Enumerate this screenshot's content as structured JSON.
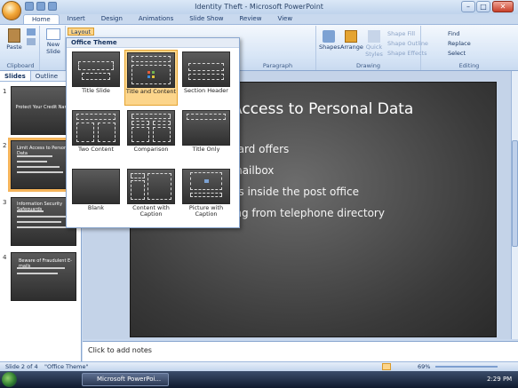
{
  "window": {
    "title": "Identity Theft - Microsoft PowerPoint"
  },
  "ribbon_tabs": [
    "Home",
    "Insert",
    "Design",
    "Animations",
    "Slide Show",
    "Review",
    "View"
  ],
  "ribbon": {
    "clipboard": {
      "paste": "Paste",
      "group": "Clipboard"
    },
    "slides": {
      "new_slide": "New Slide",
      "layout": "Layout"
    },
    "paragraph": {
      "group": "Paragraph"
    },
    "drawing": {
      "shapes": "Shapes",
      "arrange": "Arrange",
      "quick_styles": "Quick Styles",
      "shape_fill": "Shape Fill",
      "shape_outline": "Shape Outline",
      "shape_effects": "Shape Effects",
      "group": "Drawing"
    },
    "editing": {
      "find": "Find",
      "replace": "Replace",
      "select": "Select",
      "group": "Editing"
    }
  },
  "layout_gallery": {
    "header": "Office Theme",
    "layouts": [
      "Title Slide",
      "Title and Content",
      "Section Header",
      "Two Content",
      "Comparison",
      "Title Only",
      "Blank",
      "Content with Caption",
      "Picture with Caption"
    ],
    "selected": "Title and Content"
  },
  "panel_tabs": [
    "Slides",
    "Outline"
  ],
  "thumbnails": [
    {
      "num": "1",
      "title": "Protect Your Credit Name"
    },
    {
      "num": "2",
      "title": "Limit Access to Personal Data"
    },
    {
      "num": "3",
      "title": "Information Security Safeguards"
    },
    {
      "num": "4",
      "title": "Beware of Fraudulent E-mails"
    }
  ],
  "slide": {
    "title": "Access to Personal Data",
    "bullets": [
      "card offers",
      "mailbox",
      "es inside the post office",
      "ing from telephone directory"
    ]
  },
  "notes_placeholder": "Click to add notes",
  "status": {
    "slide": "Slide 2 of 4",
    "theme": "\"Office Theme\"",
    "zoom": "69%"
  },
  "taskbar": {
    "app": "Microsoft PowerPoi...",
    "time": "2:29 PM"
  }
}
